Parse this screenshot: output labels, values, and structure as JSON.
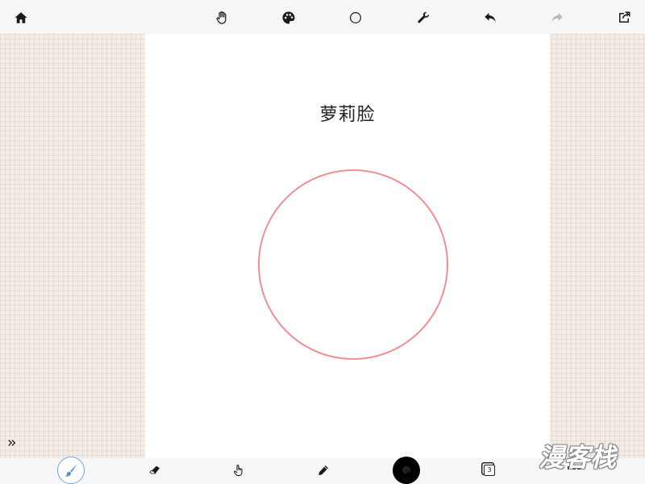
{
  "canvas": {
    "title": "萝莉脸",
    "shape_stroke_color": "#ef8e94",
    "background_color": "#ffffff"
  },
  "toolbar_top": {
    "items": [
      {
        "name": "home",
        "icon": "home-icon"
      },
      {
        "name": "hand",
        "icon": "hand-icon"
      },
      {
        "name": "palette",
        "icon": "palette-icon"
      },
      {
        "name": "shape",
        "icon": "circle-icon"
      },
      {
        "name": "settings",
        "icon": "wrench-icon"
      },
      {
        "name": "undo",
        "icon": "undo-icon"
      },
      {
        "name": "redo",
        "icon": "redo-icon",
        "disabled": true
      },
      {
        "name": "share",
        "icon": "share-icon"
      }
    ]
  },
  "toolbar_bottom": {
    "items": [
      {
        "name": "brush",
        "icon": "brush-icon",
        "active": true,
        "accent": "#6aa8e6"
      },
      {
        "name": "eraser",
        "icon": "eraser-icon"
      },
      {
        "name": "smudge",
        "icon": "finger-icon"
      },
      {
        "name": "pencil",
        "icon": "pencil-icon"
      },
      {
        "name": "color",
        "icon": "color-swatch-icon",
        "color": "#000000"
      },
      {
        "name": "layers",
        "icon": "layers-icon"
      },
      {
        "name": "more",
        "icon": "more-icon"
      }
    ],
    "layers_count": "3"
  },
  "watermark": {
    "text": "漫客栈"
  }
}
